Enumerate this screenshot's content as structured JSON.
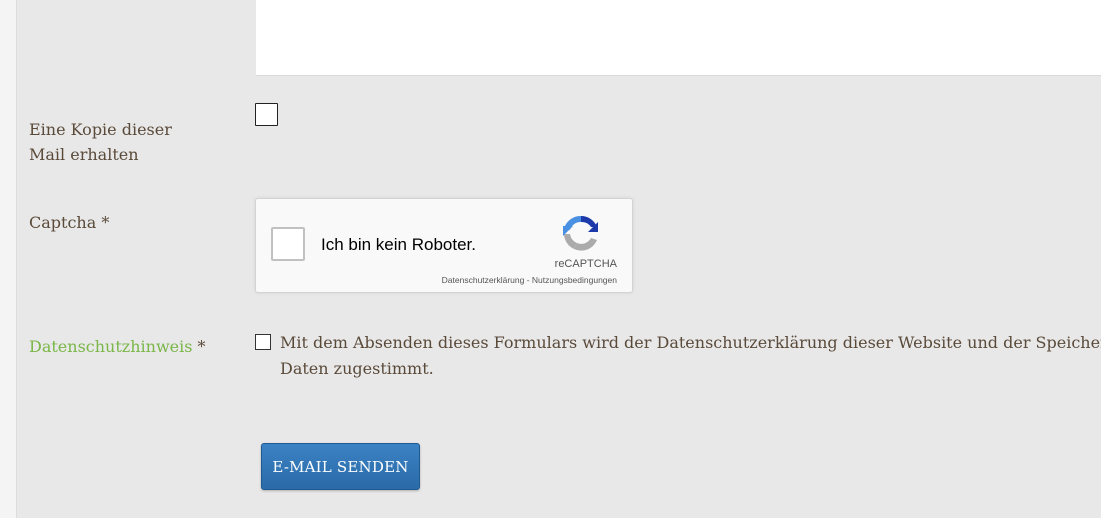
{
  "form": {
    "copy_label_line1": "Eine Kopie dieser",
    "copy_label_line2": "Mail erhalten",
    "captcha_label": "Captcha *",
    "privacy_label_link": "Datenschutzhinweis",
    "privacy_label_required": " *",
    "privacy_text_line1": "Mit dem Absenden dieses Formulars wird der Datenschutzerklärung dieser Website und der Speicherun",
    "privacy_text_line2": "Daten zugestimmt.",
    "submit_label": "E-MAIL SENDEN"
  },
  "recaptcha": {
    "checkbox_text": "Ich bin kein Roboter.",
    "brand": "reCAPTCHA",
    "privacy_link": "Datenschutzerklärung",
    "separator": " - ",
    "terms_link": "Nutzungsbedingungen",
    "icon": "recaptcha-logo-icon"
  },
  "colors": {
    "link_green": "#7ab648",
    "button_blue": "#2f74b5",
    "background": "#e8e8e8"
  }
}
